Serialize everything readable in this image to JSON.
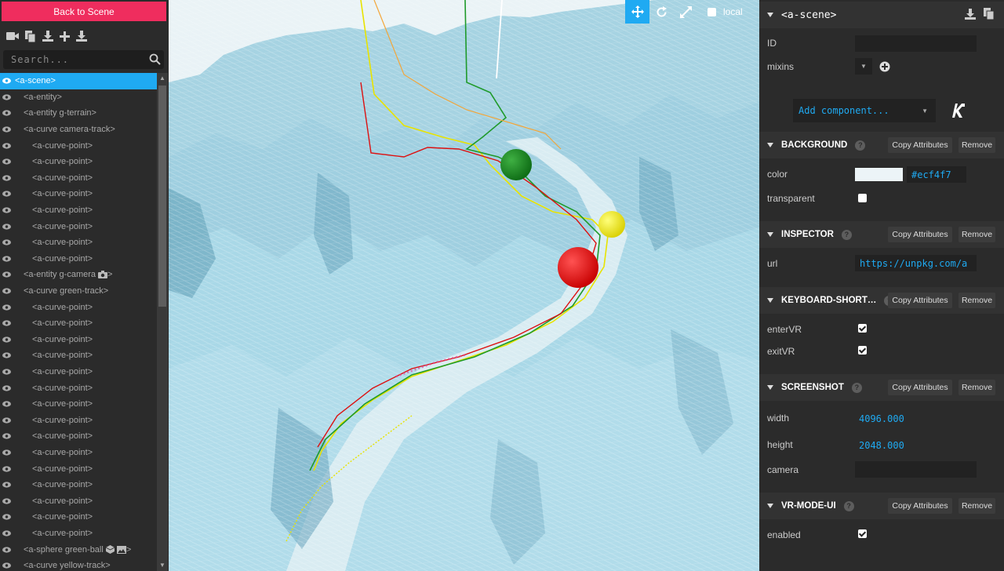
{
  "left_panel": {
    "back_button": "Back to Scene",
    "search_placeholder": "Search...",
    "tree": [
      {
        "label": "<a-scene>",
        "depth": 0,
        "selected": true
      },
      {
        "label": "<a-entity>",
        "depth": 1
      },
      {
        "label": "<a-entity g-terrain>",
        "depth": 1
      },
      {
        "label": "<a-curve camera-track>",
        "depth": 1
      },
      {
        "label": "<a-curve-point>",
        "depth": 2
      },
      {
        "label": "<a-curve-point>",
        "depth": 2
      },
      {
        "label": "<a-curve-point>",
        "depth": 2
      },
      {
        "label": "<a-curve-point>",
        "depth": 2
      },
      {
        "label": "<a-curve-point>",
        "depth": 2
      },
      {
        "label": "<a-curve-point>",
        "depth": 2
      },
      {
        "label": "<a-curve-point>",
        "depth": 2
      },
      {
        "label": "<a-curve-point>",
        "depth": 2
      },
      {
        "label": "<a-entity g-camera",
        "suffix": ">",
        "depth": 1,
        "icons": [
          "camera-icon"
        ]
      },
      {
        "label": "<a-curve green-track>",
        "depth": 1
      },
      {
        "label": "<a-curve-point>",
        "depth": 2
      },
      {
        "label": "<a-curve-point>",
        "depth": 2
      },
      {
        "label": "<a-curve-point>",
        "depth": 2
      },
      {
        "label": "<a-curve-point>",
        "depth": 2
      },
      {
        "label": "<a-curve-point>",
        "depth": 2
      },
      {
        "label": "<a-curve-point>",
        "depth": 2
      },
      {
        "label": "<a-curve-point>",
        "depth": 2
      },
      {
        "label": "<a-curve-point>",
        "depth": 2
      },
      {
        "label": "<a-curve-point>",
        "depth": 2
      },
      {
        "label": "<a-curve-point>",
        "depth": 2
      },
      {
        "label": "<a-curve-point>",
        "depth": 2
      },
      {
        "label": "<a-curve-point>",
        "depth": 2
      },
      {
        "label": "<a-curve-point>",
        "depth": 2
      },
      {
        "label": "<a-curve-point>",
        "depth": 2
      },
      {
        "label": "<a-curve-point>",
        "depth": 2
      },
      {
        "label": "<a-sphere green-ball",
        "suffix": ">",
        "depth": 1,
        "icons": [
          "cube-icon",
          "image-icon"
        ]
      },
      {
        "label": "<a-curve yellow-track>",
        "depth": 1
      },
      {
        "label": "<a-curve-point>",
        "depth": 2
      }
    ]
  },
  "viewport": {
    "local_label": "local"
  },
  "right_panel": {
    "entity_title": "<a-scene>",
    "id_label": "ID",
    "mixins_label": "mixins",
    "add_component_label": "Add component...",
    "copy_label": "Copy Attributes",
    "remove_label": "Remove",
    "background": {
      "title": "BACKGROUND",
      "color_label": "color",
      "color_value": "#ecf4f7",
      "transparent_label": "transparent",
      "transparent": false
    },
    "inspector": {
      "title": "INSPECTOR",
      "url_label": "url",
      "url_value": "https://unpkg.com/a"
    },
    "keyboard": {
      "title": "KEYBOARD-SHORT…",
      "enter_label": "enterVR",
      "exit_label": "exitVR",
      "enter": true,
      "exit": true
    },
    "screenshot": {
      "title": "SCREENSHOT",
      "width_label": "width",
      "width_value": "4096.000",
      "height_label": "height",
      "height_value": "2048.000",
      "camera_label": "camera"
    },
    "vrmode": {
      "title": "VR-MODE-UI",
      "enabled_label": "enabled",
      "enabled": true
    }
  },
  "colors": {
    "accent": "#1faaf2",
    "back_button": "#ef2d5e",
    "ball_green": "#16881c",
    "ball_yellow": "#f4f023",
    "ball_red": "#ee1a1a",
    "terrain": "#a9d7e6"
  }
}
